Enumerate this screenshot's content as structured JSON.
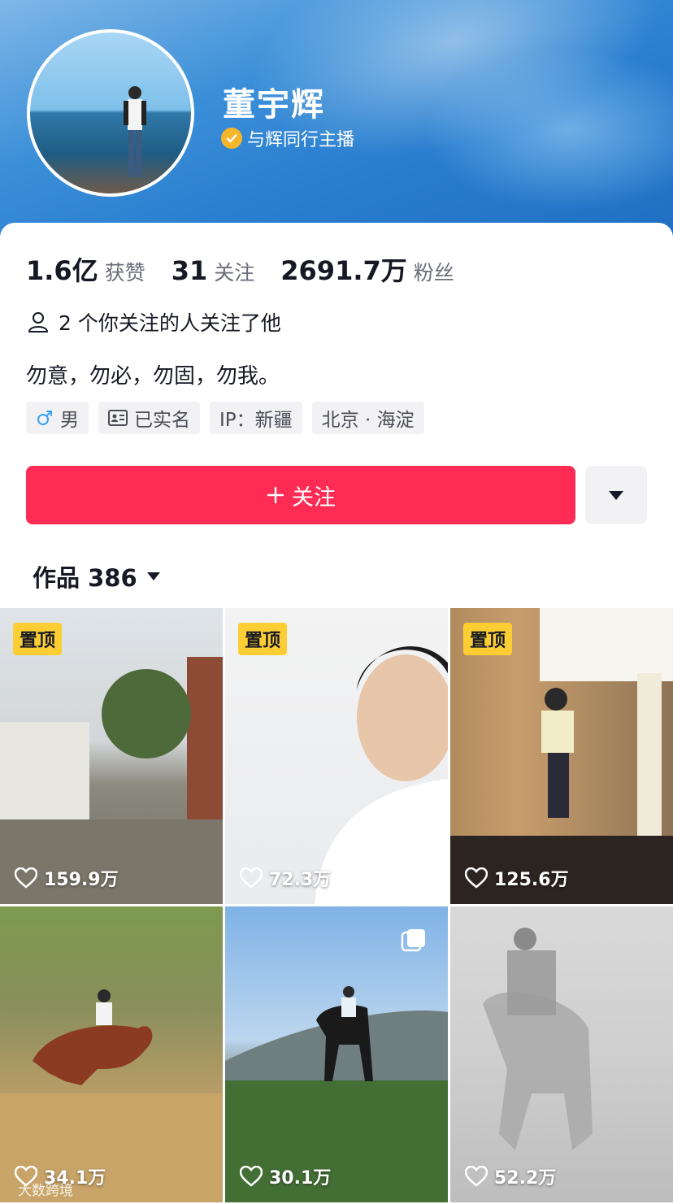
{
  "profile": {
    "name": "董宇辉",
    "verification": "与辉同行主播"
  },
  "stats": [
    {
      "value": "1.6亿",
      "label": "获赞"
    },
    {
      "value": "31",
      "label": "关注"
    },
    {
      "value": "2691.7万",
      "label": "粉丝"
    }
  ],
  "mutual": "2 个你关注的人关注了他",
  "bio": "勿意，勿必，勿固，勿我。",
  "tags": {
    "gender": "男",
    "real_name": "已实名",
    "ip": "IP：新疆",
    "location": "北京 · 海淀"
  },
  "actions": {
    "follow": "关注"
  },
  "works_tab": {
    "label": "作品 386"
  },
  "pin_label": "置顶",
  "videos": [
    {
      "likes": "159.9万",
      "pinned": true
    },
    {
      "likes": "72.3万",
      "pinned": true
    },
    {
      "likes": "125.6万",
      "pinned": true
    },
    {
      "likes": "34.1万",
      "pinned": false
    },
    {
      "likes": "30.1万",
      "pinned": false
    },
    {
      "likes": "52.2万",
      "pinned": false
    }
  ],
  "watermark": "大数跨境",
  "colors": {
    "accent": "#fe2c55",
    "pin": "#fcce34",
    "verify": "#f6b62a"
  }
}
